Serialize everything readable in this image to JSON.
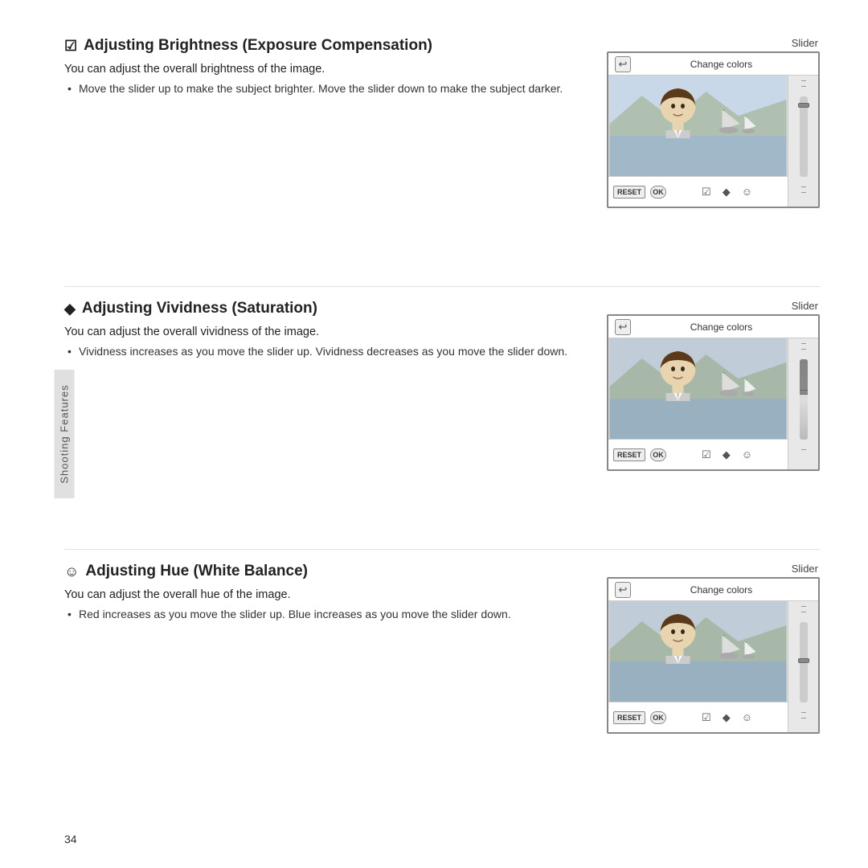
{
  "page": {
    "number": "34",
    "sidebar_label": "Shooting Features"
  },
  "sections": [
    {
      "id": "brightness",
      "icon_label": "☑",
      "title": "Adjusting Brightness (Exposure Compensation)",
      "description": "You can adjust the overall brightness of the image.",
      "bullets": [
        "Move the slider up to make the subject brighter. Move the slider down to make the subject darker."
      ],
      "slider_label": "Slider",
      "screen": {
        "back_icon": "↩",
        "title": "Change colors",
        "reset_label": "RESET",
        "ok_label": "OK",
        "slider_position": "top"
      }
    },
    {
      "id": "vividness",
      "icon_label": "◆",
      "title": "Adjusting Vividness (Saturation)",
      "description": "You can adjust the overall vividness of the image.",
      "bullets": [
        "Vividness increases as you move the slider up. Vividness decreases as you move the slider down."
      ],
      "slider_label": "Slider",
      "screen": {
        "back_icon": "↩",
        "title": "Change colors",
        "reset_label": "RESET",
        "ok_label": "OK",
        "slider_position": "middle"
      }
    },
    {
      "id": "hue",
      "icon_label": "☺",
      "title": "Adjusting Hue (White Balance)",
      "description": "You can adjust the overall hue of the image.",
      "bullets": [
        "Red increases as you move the slider up. Blue increases as you move the slider down."
      ],
      "slider_label": "Slider",
      "screen": {
        "back_icon": "↩",
        "title": "Change colors",
        "reset_label": "RESET",
        "ok_label": "OK",
        "slider_position": "middle"
      }
    }
  ]
}
